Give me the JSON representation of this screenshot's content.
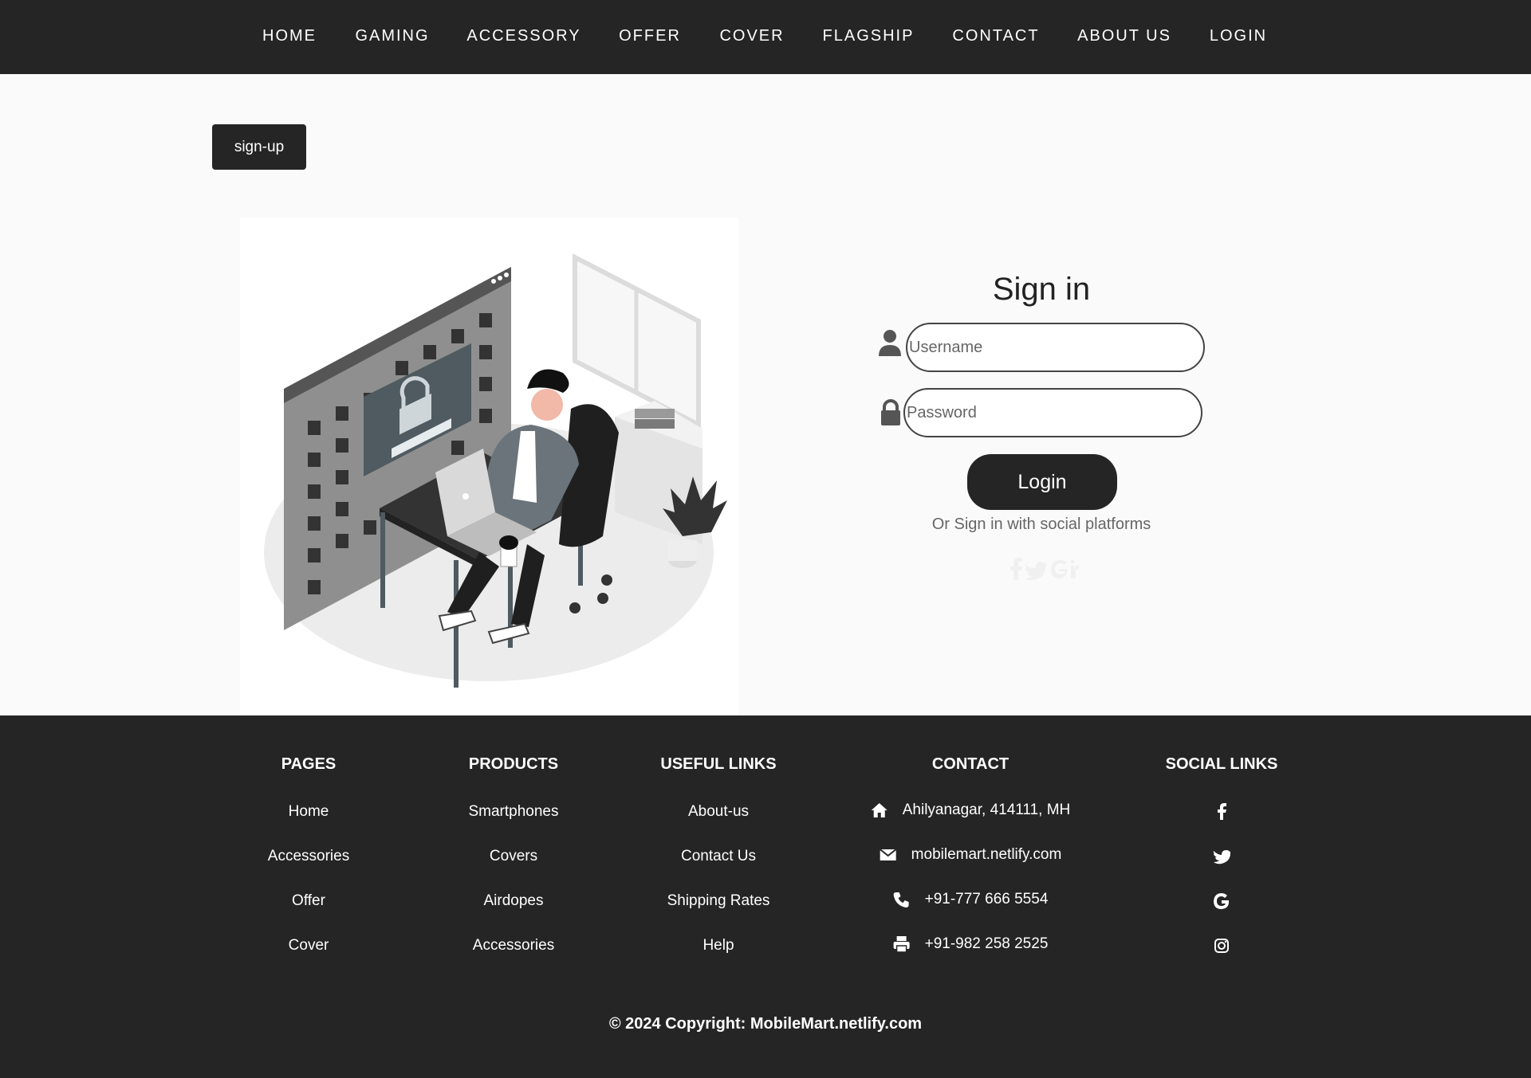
{
  "nav": {
    "items": [
      {
        "label": "HOME"
      },
      {
        "label": "GAMING"
      },
      {
        "label": "ACCESSORY"
      },
      {
        "label": "OFFER"
      },
      {
        "label": "COVER"
      },
      {
        "label": "FLAGSHIP"
      },
      {
        "label": "CONTACT"
      },
      {
        "label": "ABOUT US"
      },
      {
        "label": "LOGIN"
      }
    ]
  },
  "signup": {
    "label": "sign-up"
  },
  "signin": {
    "title": "Sign in",
    "username_placeholder": "Username",
    "password_placeholder": "Password",
    "login_label": "Login",
    "social_text": "Or Sign in with social platforms",
    "social_icons": [
      "facebook-icon",
      "twitter-icon",
      "google-icon",
      "linkedin-icon"
    ]
  },
  "footer": {
    "pages": {
      "heading": "PAGES",
      "links": [
        "Home",
        "Accessories",
        "Offer",
        "Cover"
      ]
    },
    "products": {
      "heading": "PRODUCTS",
      "links": [
        "Smartphones",
        "Covers",
        "Airdopes",
        "Accessories"
      ]
    },
    "useful": {
      "heading": "USEFUL LINKS",
      "links": [
        "About-us",
        "Contact Us",
        "Shipping Rates",
        "Help"
      ]
    },
    "contact": {
      "heading": "CONTACT",
      "items": [
        {
          "icon": "home-icon",
          "text": "Ahilyanagar, 414111, MH"
        },
        {
          "icon": "envelope-icon",
          "text": "mobilemart.netlify.com"
        },
        {
          "icon": "phone-icon",
          "text": "+91-777 666 5554"
        },
        {
          "icon": "print-icon",
          "text": "+91-982 258 2525"
        }
      ]
    },
    "social": {
      "heading": "SOCIAL LINKS",
      "icons": [
        "facebook-icon",
        "twitter-icon",
        "google-icon",
        "instagram-icon"
      ]
    },
    "copyright": "© 2024 Copyright: MobileMart.netlify.com"
  },
  "colors": {
    "dark": "#252525",
    "background": "#fafafa",
    "text_muted": "#666666"
  }
}
